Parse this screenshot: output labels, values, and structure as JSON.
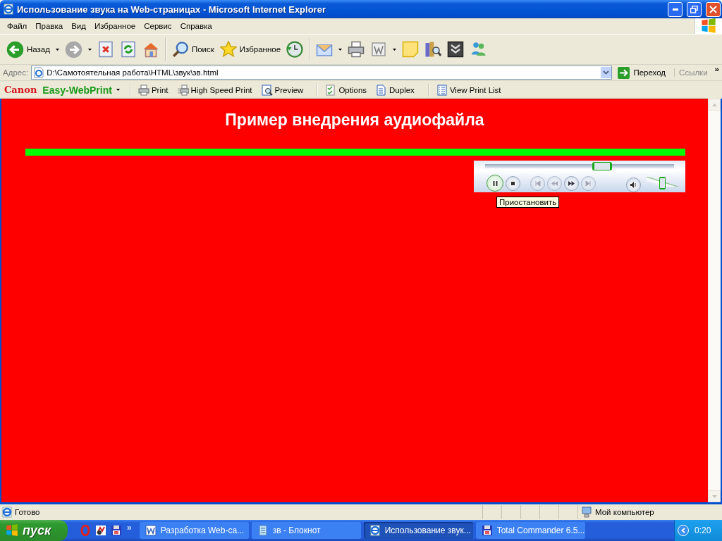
{
  "window": {
    "title": "Использование звука на Web-страницах - Microsoft Internet Explorer"
  },
  "menu": [
    "Файл",
    "Правка",
    "Вид",
    "Избранное",
    "Сервис",
    "Справка"
  ],
  "toolbar": [
    {
      "kind": "back",
      "label": "Назад",
      "dropdown": true
    },
    {
      "kind": "forward",
      "dropdown": true
    },
    {
      "kind": "stop"
    },
    {
      "kind": "refresh"
    },
    {
      "kind": "home"
    },
    {
      "kind": "separator"
    },
    {
      "kind": "search",
      "label": "Поиск"
    },
    {
      "kind": "favorites",
      "label": "Избранное"
    },
    {
      "kind": "history"
    },
    {
      "kind": "separator"
    },
    {
      "kind": "mail",
      "dropdown": true
    },
    {
      "kind": "print"
    },
    {
      "kind": "edit",
      "dropdown": true
    },
    {
      "kind": "note"
    },
    {
      "kind": "research"
    },
    {
      "kind": "download"
    },
    {
      "kind": "messenger"
    }
  ],
  "address": {
    "label": "Адрес:",
    "value": "D:\\Самотоятельная работа\\HTML\\звук\\зв.html",
    "go": "Переход",
    "links": "Ссылки",
    "more": "»"
  },
  "print_bar": {
    "brand": "Canon",
    "product": "Easy-WebPrint",
    "buttons": [
      {
        "kind": "print",
        "label": "Print"
      },
      {
        "kind": "fastprint",
        "label": "High Speed Print"
      },
      {
        "kind": "preview",
        "label": "Preview"
      },
      {
        "kind": "options",
        "label": "Options"
      },
      {
        "kind": "duplex",
        "label": "Duplex"
      },
      {
        "kind": "list",
        "label": "View Print List"
      }
    ]
  },
  "page": {
    "heading": "Пример внедрения аудиофайла",
    "player": {
      "playing": true,
      "position": {
        "level": 0.61
      },
      "volume": {
        "level": 0.5
      },
      "tooltip": "Приостановить"
    }
  },
  "status_bar": {
    "text": "Готово",
    "zone": "Мой компьютер"
  },
  "taskbar": {
    "start": "пуск",
    "more": "»",
    "quick_launch": [
      {
        "kind": "opera"
      },
      {
        "kind": "app"
      },
      {
        "kind": "floppy"
      }
    ],
    "tasks": [
      {
        "kind": "word",
        "label": "Разработка Web-са...",
        "selected": false
      },
      {
        "kind": "notepad",
        "label": "зв - Блокнот",
        "selected": false
      },
      {
        "kind": "ie",
        "label": "Использование звук...",
        "selected": true
      },
      {
        "kind": "floppy",
        "label": "Total Commander 6.5...",
        "selected": false
      }
    ],
    "clock": "0:20"
  }
}
